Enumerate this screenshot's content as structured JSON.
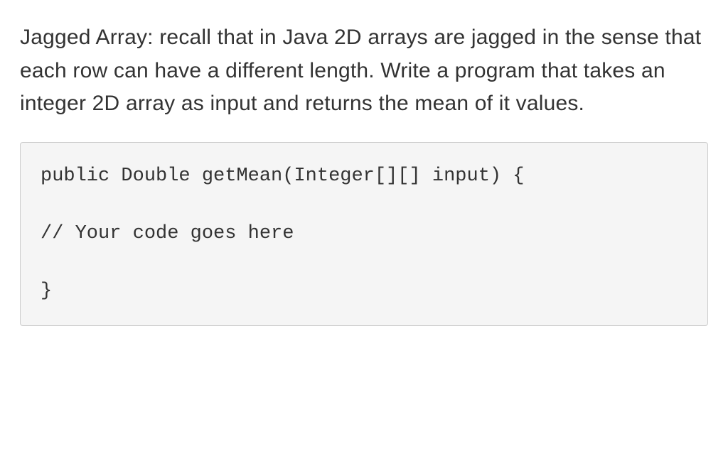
{
  "problem": {
    "text": "Jagged Array: recall that in Java 2D arrays are jagged in the sense that each row can have a different length. Write a program that takes an integer 2D array as input and returns the mean of it values."
  },
  "code": {
    "line1": "public Double getMean(Integer[][] input) {",
    "line2": "// Your code goes here",
    "line3": "}"
  }
}
